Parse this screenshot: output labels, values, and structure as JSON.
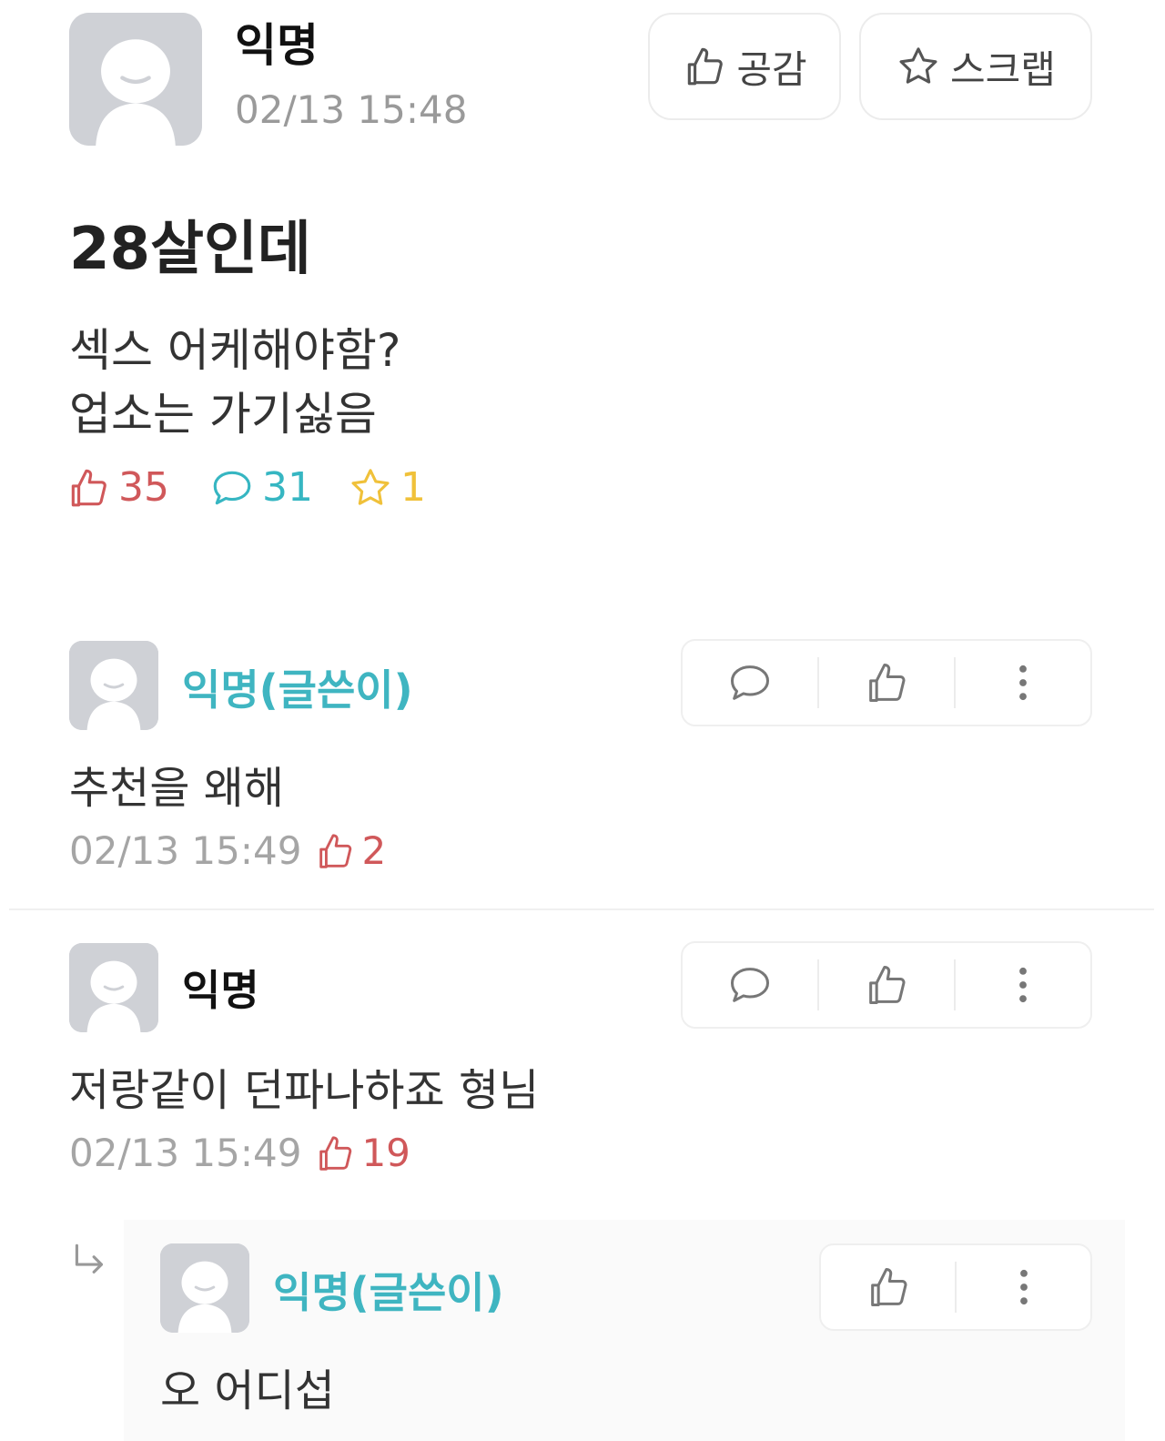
{
  "post": {
    "author": "익명",
    "time": "02/13 15:48",
    "title": "28살인데",
    "body_lines": [
      "섹스 어케해야함?",
      "업소는 가기싫음"
    ],
    "like_button_label": "공감",
    "scrap_button_label": "스크랩",
    "stats": {
      "likes": "35",
      "comments": "31",
      "scraps": "1"
    }
  },
  "comments": [
    {
      "author": "익명(글쓴이)",
      "body": "추천을 왜해",
      "time": "02/13 15:49",
      "likes": "2"
    },
    {
      "author": "익명",
      "body": "저랑같이 던파나하죠 형님",
      "time": "02/13 15:49",
      "likes": "19",
      "replies": [
        {
          "author": "익명(글쓴이)",
          "body": "오 어디섭"
        }
      ]
    }
  ],
  "icons": {
    "like": "thumbs-up-icon",
    "comment": "speech-bubble-icon",
    "scrap": "star-icon",
    "more": "kebab-menu-icon",
    "reply": "reply-arrow-icon"
  },
  "colors": {
    "like": "#d0585a",
    "comment": "#36b6c2",
    "scrap": "#f0c13a",
    "op_name": "#3fb5c1",
    "avatar": "#cfd1d6"
  }
}
